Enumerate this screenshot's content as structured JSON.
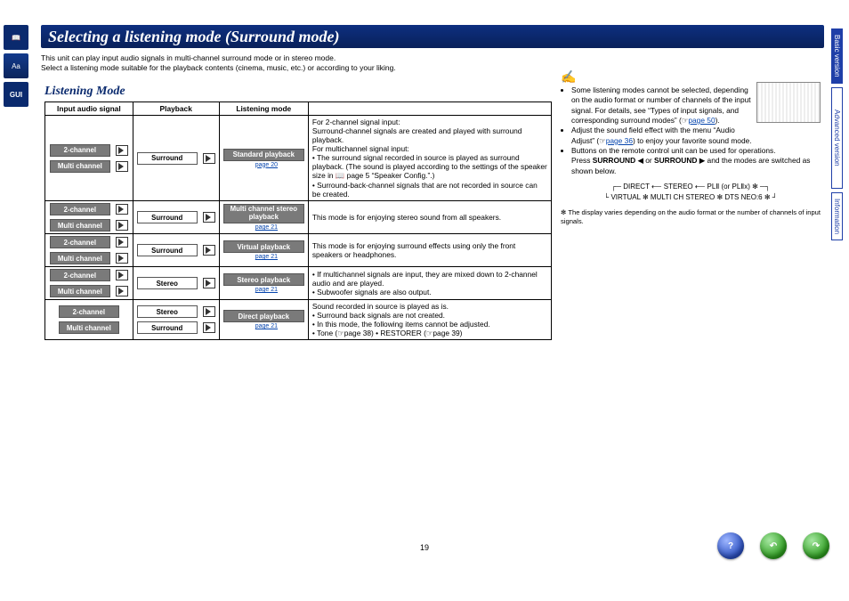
{
  "page_number": "19",
  "title": "Selecting a listening mode (Surround mode)",
  "intro_line1": "This unit can play input audio signals in multi-channel surround mode or in stereo mode.",
  "intro_line2": "Select a listening mode suitable for the playback contents (cinema, music, etc.) or according to your liking.",
  "section_heading": "Listening Mode",
  "headers": {
    "input": "Input audio signal",
    "playback": "Playback",
    "mode": "Listening mode"
  },
  "labels": {
    "ch2": "2-channel",
    "multi": "Multi channel",
    "surround": "Surround",
    "stereo": "Stereo"
  },
  "rows": [
    {
      "mode_title": "Standard playback",
      "mode_ref": "page 20",
      "desc": "For 2-channel signal input:\nSurround-channel signals are created and played with surround playback.\nFor multichannel signal input:\n• The surround signal recorded in source is played as surround playback. (The sound is played according to the settings of the speaker size in 📖 page 5 “Speaker Config.”.)\n• Surround-back-channel signals that are not recorded in source can be created."
    },
    {
      "mode_title": "Multi channel stereo playback",
      "mode_ref": "page 21",
      "desc": "This mode is for enjoying stereo sound from all speakers."
    },
    {
      "mode_title": "Virtual playback",
      "mode_ref": "page 21",
      "desc": "This mode is for enjoying surround effects using only the front speakers or headphones."
    },
    {
      "mode_title": "Stereo playback",
      "mode_ref": "page 21",
      "desc": "• If multichannel signals are input, they are mixed down to 2-channel audio and are played.\n• Subwoofer signals are also output."
    },
    {
      "mode_title": "Direct playback",
      "mode_ref": "page 21",
      "desc": "Sound recorded in source is played as is.\n• Surround back signals are not created.\n• In this mode, the following items cannot be adjusted.\n   • Tone (☞page 38)             • RESTORER (☞page 39)"
    }
  ],
  "notes": {
    "b1a": "Some listening modes cannot be selected, depending on the audio format or number of channels of the input signal. For details, see “Types of input signals, and corresponding surround modes” (☞",
    "b1_link": "page 50",
    "b1b": ").",
    "b2a": "Adjust the sound field effect with the menu “Audio Adjust” (☞",
    "b2_link": "page 36",
    "b2b": ") to enjoy your favorite sound mode.",
    "b3": "Buttons on the remote control unit can be used for operations.",
    "b3_press_a": "Press ",
    "b3_sur": "SURROUND",
    "b3_or": " or ",
    "b3_press_b": " and the modes are switched as shown below.",
    "graph_l1": "DIRECT ⟵ STEREO ⟵ PLⅡ (or PLⅡx) ✻",
    "graph_l2": "VIRTUAL ✻   MULTI CH STEREO ✻   DTS NEO:6 ✻",
    "foot": "✻ The display varies depending on the audio format or the number of channels of input signals."
  },
  "right_tabs": {
    "basic": "Basic version",
    "advanced": "Advanced version",
    "info": "Information"
  },
  "left_icons": {
    "book": "📖",
    "aa": "Aa",
    "gui": "GUI"
  }
}
